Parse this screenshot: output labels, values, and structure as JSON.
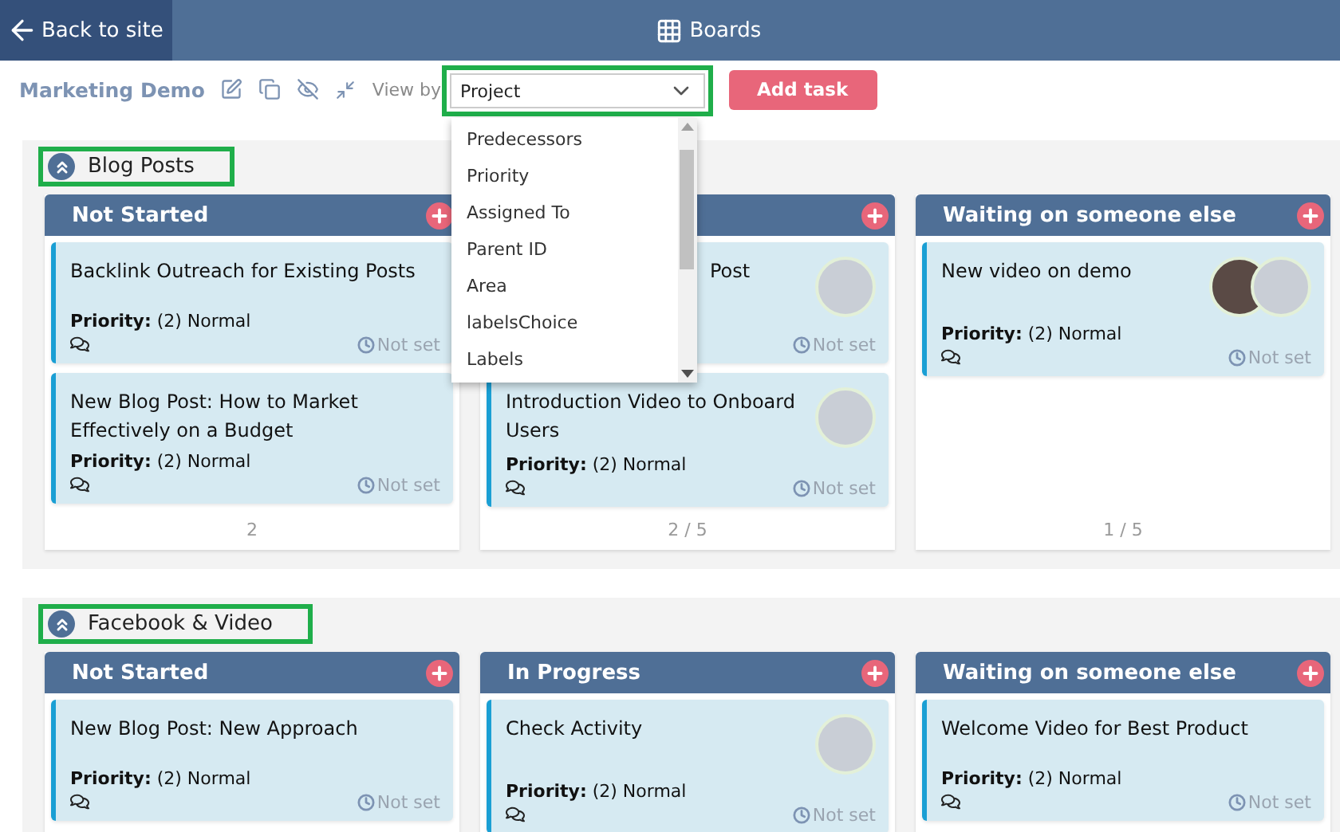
{
  "top_bar": {
    "back_link": "Back to site",
    "title": "Boards"
  },
  "toolbar": {
    "board_name": "Marketing Demo",
    "view_by_label": "View by",
    "view_by_value": "Project",
    "add_button": "Add task",
    "dropdown": {
      "open": true,
      "options": [
        "Predecessors",
        "Priority",
        "Assigned To",
        "Parent ID",
        "Area",
        "labelsChoice",
        "Labels"
      ]
    }
  },
  "groups": [
    {
      "title": "Blog Posts",
      "expanded": true,
      "columns": [
        {
          "title": "Not Started",
          "count": "2",
          "cards": [
            {
              "title": "Backlink Outreach for Existing Posts",
              "covered": false,
              "priority_label": "Priority:",
              "priority": "(2) Normal",
              "due": "Not set"
            },
            {
              "title": "New Blog Post: How to Market Effectively on a Budget",
              "covered": false,
              "priority_label": "Priority:",
              "priority": "(2) Normal",
              "due": "Not set"
            }
          ]
        },
        {
          "count": "2 / 5",
          "cards": [
            {
              "title": "Post",
              "covered": true,
              "due": "Not set",
              "avatars": [
                {
                  "kind": "photo"
                }
              ]
            },
            {
              "title": "Introduction Video to Onboard Users",
              "covered": false,
              "priority_label": "Priority:",
              "priority": "(2) Normal",
              "due": "Not set",
              "avatars": [
                {
                  "kind": "photo"
                }
              ]
            }
          ]
        },
        {
          "title": "Waiting on someone else",
          "count": "1 / 5",
          "cards": [
            {
              "title": "New video on demo",
              "covered": false,
              "priority_label": "Priority:",
              "priority": "(2) Normal",
              "due": "Not set",
              "avatars": [
                {
                  "kind": "photo"
                },
                {
                  "kind": "photo"
                }
              ]
            }
          ]
        }
      ]
    },
    {
      "title": "Facebook & Video",
      "expanded": true,
      "columns": [
        {
          "title": "Not Started",
          "cards": [
            {
              "title": "New Blog Post: New Approach",
              "covered": false,
              "priority_label": "Priority:",
              "priority": "(2) Normal",
              "due": "Not set"
            }
          ]
        },
        {
          "title": "In Progress",
          "cards": [
            {
              "title": "Check Activity",
              "covered": false,
              "priority_label": "Priority:",
              "priority": "(2) Normal",
              "due": "Not set",
              "avatars": [
                {
                  "kind": "photo"
                }
              ]
            }
          ]
        },
        {
          "title": "Waiting on someone else",
          "cards": [
            {
              "title": "Welcome Video for Best Product",
              "covered": false,
              "priority_label": "Priority:",
              "priority": "(2) Normal",
              "due": "Not set"
            }
          ]
        }
      ]
    }
  ]
}
